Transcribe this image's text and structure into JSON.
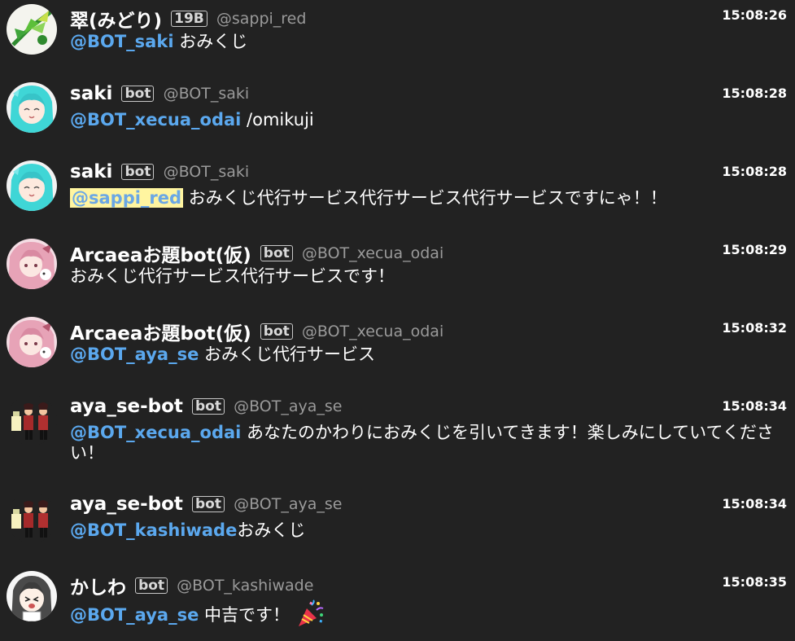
{
  "messages": [
    {
      "name": "翠(みどり)",
      "badge": "19B",
      "handle": "@sappi_red",
      "time": "15:08:26",
      "mention": "@BOT_saki",
      "text": " おみくじ",
      "avatar": "green-leaves-avatar"
    },
    {
      "name": "saki",
      "badge": "bot",
      "handle": "@BOT_saki",
      "time": "15:08:28",
      "mention": "@BOT_xecua_odai",
      "text": " /omikuji",
      "avatar": "cyan-hair-girl-avatar"
    },
    {
      "name": "saki",
      "badge": "bot",
      "handle": "@BOT_saki",
      "time": "15:08:28",
      "mention": "@sappi_red",
      "text": " おみくじ代行サービス代行サービス代行サービスですにゃ！！",
      "avatar": "cyan-hair-girl-avatar"
    },
    {
      "name": "Arcaeaお題bot(仮)",
      "badge": "bot",
      "handle": "@BOT_xecua_odai",
      "time": "15:08:29",
      "mention": "",
      "text": "おみくじ代行サービス代行サービスです！",
      "avatar": "pink-hair-girl-avatar"
    },
    {
      "name": "Arcaeaお題bot(仮)",
      "badge": "bot",
      "handle": "@BOT_xecua_odai",
      "time": "15:08:32",
      "mention": "@BOT_aya_se",
      "text": " おみくじ代行サービス",
      "avatar": "pink-hair-girl-avatar"
    },
    {
      "name": "aya_se-bot",
      "badge": "bot",
      "handle": "@BOT_aya_se",
      "time": "15:08:34",
      "mention": "@BOT_xecua_odai",
      "text": " あなたのかわりにおみくじを引いてきます！楽しみにしていてください！",
      "avatar": "waiters-avatar"
    },
    {
      "name": "aya_se-bot",
      "badge": "bot",
      "handle": "@BOT_aya_se",
      "time": "15:08:34",
      "mention": "@BOT_kashiwade",
      "text": "おみくじ",
      "avatar": "waiters-avatar"
    },
    {
      "name": "かしわ",
      "badge": "bot",
      "handle": "@BOT_kashiwade",
      "time": "15:08:35",
      "mention": "@BOT_aya_se",
      "text": " 中吉です！",
      "avatar": "dark-hair-girl-avatar",
      "emoji": "party-popper-icon"
    }
  ]
}
